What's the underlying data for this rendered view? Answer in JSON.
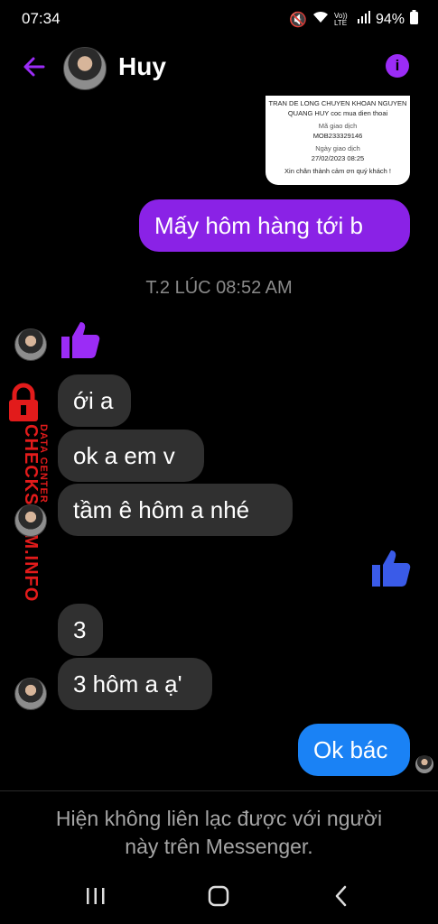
{
  "status": {
    "time": "07:34",
    "battery": "94%",
    "network": "Vo)) LTE"
  },
  "header": {
    "contact_name": "Huy"
  },
  "receipt": {
    "line1": "TRAN DE LONG CHUYEN KHOAN NGUYEN",
    "line2": "QUANG HUY coc mua dien thoai",
    "code_label": "Mã giao dịch",
    "code": "MOB233329146",
    "date_label": "Ngày giao dịch",
    "date": "27/02/2023 08:25",
    "thanks": "Xin chân thành cảm ơn quý khách !"
  },
  "messages": {
    "m1": "Mấy hôm hàng tới b",
    "timestamp": "T.2 LÚC 08:52 AM",
    "m2": "ới a",
    "m3": "ok a em v",
    "m4": "tầm ê hôm a nhé",
    "m5": "3",
    "m6": "3 hôm a ạ'",
    "m7": "Ok bác"
  },
  "watermark": {
    "brand": "CHECKSCAM.INFO",
    "sub": "DATA CENTER"
  },
  "footer": {
    "notice_line1": "Hiện không liên lạc được với người",
    "notice_line2": "này trên Messenger."
  },
  "colors": {
    "purple": "#8a22e6",
    "blue": "#1a82f5",
    "incoming": "#303030",
    "watermark": "#e21b1b"
  }
}
